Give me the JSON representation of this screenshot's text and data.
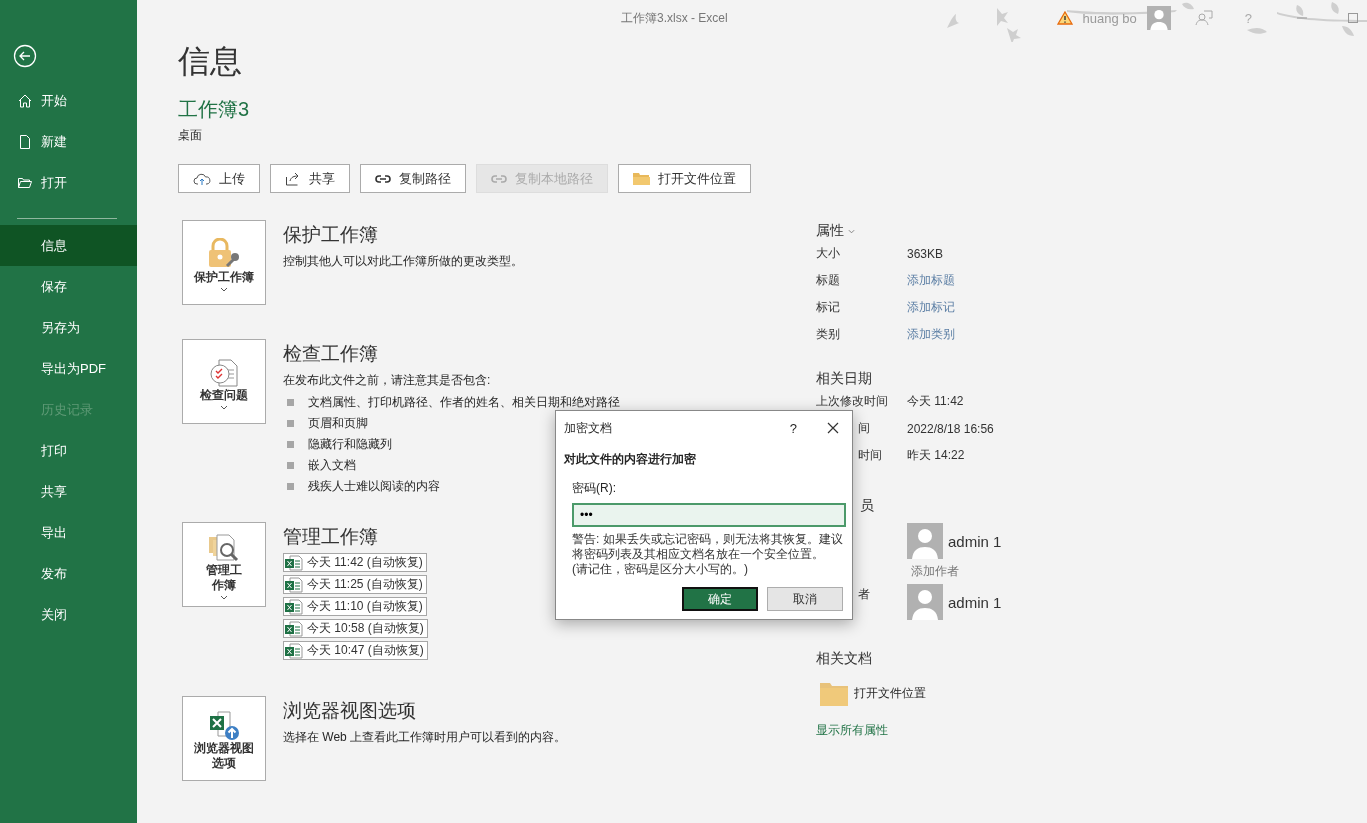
{
  "window": {
    "title": "工作簿3.xlsx  -  Excel",
    "user": "huang bo",
    "help": "?"
  },
  "sidebar": {
    "items": [
      {
        "label": "开始",
        "kind": "home",
        "selected": false,
        "disabled": false
      },
      {
        "label": "新建",
        "kind": "file",
        "selected": false,
        "disabled": false
      },
      {
        "label": "打开",
        "kind": "folder",
        "selected": false,
        "disabled": false
      },
      {
        "label": "信息",
        "kind": "plain",
        "selected": true,
        "disabled": false
      },
      {
        "label": "保存",
        "kind": "plain",
        "selected": false,
        "disabled": false
      },
      {
        "label": "另存为",
        "kind": "plain",
        "selected": false,
        "disabled": false
      },
      {
        "label": "导出为PDF",
        "kind": "plain",
        "selected": false,
        "disabled": false
      },
      {
        "label": "历史记录",
        "kind": "plain",
        "selected": false,
        "disabled": true
      },
      {
        "label": "打印",
        "kind": "plain",
        "selected": false,
        "disabled": false
      },
      {
        "label": "共享",
        "kind": "plain",
        "selected": false,
        "disabled": false
      },
      {
        "label": "导出",
        "kind": "plain",
        "selected": false,
        "disabled": false
      },
      {
        "label": "发布",
        "kind": "plain",
        "selected": false,
        "disabled": false
      },
      {
        "label": "关闭",
        "kind": "plain",
        "selected": false,
        "disabled": false
      }
    ]
  },
  "page": {
    "heading": "信息",
    "workbook": "工作簿3",
    "location": "桌面"
  },
  "actions": [
    {
      "label": "上传",
      "kind": "upload",
      "disabled": false
    },
    {
      "label": "共享",
      "kind": "share",
      "disabled": false
    },
    {
      "label": "复制路径",
      "kind": "link",
      "disabled": false
    },
    {
      "label": "复制本地路径",
      "kind": "link",
      "disabled": true
    },
    {
      "label": "打开文件位置",
      "kind": "folder",
      "disabled": false
    }
  ],
  "sections": [
    {
      "kind": "protect",
      "button": [
        "保护工作簿"
      ],
      "title": "保护工作簿",
      "description": "控制其他人可以对此工作簿所做的更改类型。"
    },
    {
      "kind": "inspect",
      "button": [
        "检查问题"
      ],
      "title": "检查工作簿",
      "description": "在发布此文件之前，请注意其是否包含:",
      "bullets": [
        "文档属性、打印机路径、作者的姓名、相关日期和绝对路径",
        "页眉和页脚",
        "隐藏行和隐藏列",
        "嵌入文档",
        "残疾人士难以阅读的内容"
      ]
    },
    {
      "kind": "manage",
      "button": [
        "管理工",
        "作簿"
      ],
      "title": "管理工作簿",
      "versions": [
        "今天 11:42 (自动恢复)",
        "今天 11:25 (自动恢复)",
        "今天 11:10 (自动恢复)",
        "今天 10:58 (自动恢复)",
        "今天 10:47 (自动恢复)"
      ]
    },
    {
      "kind": "browser",
      "button": [
        "浏览器视图",
        "选项"
      ],
      "title": "浏览器视图选项",
      "description": "选择在 Web 上查看此工作簿时用户可以看到的内容。"
    }
  ],
  "properties": {
    "heading": "属性",
    "rows": [
      {
        "label": "大小",
        "value": "363KB",
        "kind": "value"
      },
      {
        "label": "标题",
        "value": "添加标题",
        "kind": "link"
      },
      {
        "label": "标记",
        "value": "添加标记",
        "kind": "link"
      },
      {
        "label": "类别",
        "value": "添加类别",
        "kind": "link"
      }
    ]
  },
  "dates": {
    "heading": "相关日期",
    "rows": [
      {
        "label": "上次修改时间",
        "value": "今天 11:42",
        "covered": false
      },
      {
        "label": "间",
        "value": "2022/8/18 16:56",
        "covered": true
      },
      {
        "label": "时间",
        "value": "昨天 14:22",
        "covered": true
      }
    ]
  },
  "people": {
    "heading": "员",
    "covered": true,
    "rows": [
      {
        "name": "admin 1",
        "action": "添加作者"
      },
      {
        "label": "者",
        "covered": true,
        "name": "admin 1"
      }
    ]
  },
  "related": {
    "heading": "相关文档",
    "items": [
      "打开文件位置"
    ],
    "show_all": "显示所有属性"
  },
  "dialog": {
    "title": "加密文档",
    "help": "?",
    "heading": "对此文件的内容进行加密",
    "field_label": "密码(R):",
    "value": "•••",
    "warning": "警告: 如果丢失或忘记密码，则无法将其恢复。建议将密码列表及其相应文档名放在一个安全位置。",
    "note": "(请记住，密码是区分大小写的。)",
    "buttons": [
      {
        "label": "确定",
        "primary": true
      },
      {
        "label": "取消",
        "primary": false
      }
    ]
  }
}
